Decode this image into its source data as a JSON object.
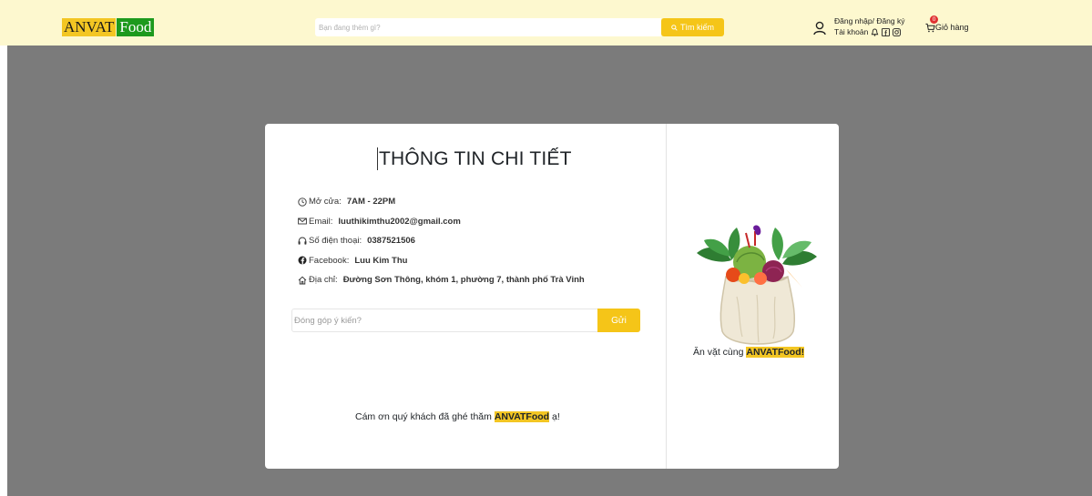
{
  "header": {
    "logo_part1": "ANVAT",
    "logo_part2": "Food",
    "search_placeholder": "Bạn đang thèm gì?",
    "search_button": "Tìm kiếm",
    "login_link": "Đăng nhập/ Đăng ký",
    "account_label": "Tài khoản",
    "cart_label": "Giỏ hàng",
    "cart_count": "0"
  },
  "modal": {
    "title": "THÔNG TIN CHI TIẾT",
    "info": [
      {
        "label": "Mở cửa:",
        "value": "7AM - 22PM",
        "icon": "clock-icon"
      },
      {
        "label": "Email:",
        "value": "luuthikimthu2002@gmail.com",
        "icon": "envelope-icon"
      },
      {
        "label": "Số điện thoại:",
        "value": "0387521506",
        "icon": "headset-icon"
      },
      {
        "label": "Facebook:",
        "value": "Luu Kim Thu",
        "icon": "facebook-icon"
      },
      {
        "label": "Địa chỉ:",
        "value": "Đường Sơn Thông, khóm 1, phường 7, thành phố Trà Vinh",
        "icon": "home-icon"
      }
    ],
    "feedback_placeholder": "Đóng góp ý kiến?",
    "send_button": "Gửi",
    "thanks_prefix": "Cám ơn quý khách đã ghé thăm ",
    "thanks_brand": "ANVATFood",
    "thanks_suffix": " ạ!",
    "side_prefix": "Ăn vặt cùng ",
    "side_brand": "ANVATFood!"
  },
  "colors": {
    "accent": "#f5c518",
    "header_bg": "#fdf8cf",
    "overlay": "#7b7b7b",
    "logo_green": "#1d9a1d"
  }
}
